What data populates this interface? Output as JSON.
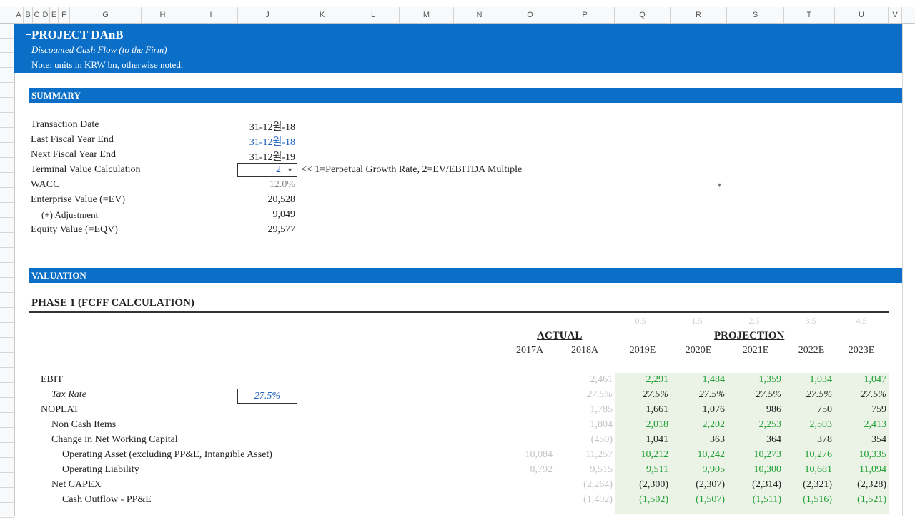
{
  "columns": [
    {
      "label": "A",
      "l": 20,
      "w": 13
    },
    {
      "label": "B",
      "l": 33,
      "w": 13
    },
    {
      "label": "C",
      "l": 46,
      "w": 12
    },
    {
      "label": "D",
      "l": 58,
      "w": 12
    },
    {
      "label": "E",
      "l": 70,
      "w": 12
    },
    {
      "label": "F",
      "l": 82,
      "w": 16
    },
    {
      "label": "G",
      "l": 98,
      "w": 100
    },
    {
      "label": "H",
      "l": 198,
      "w": 60
    },
    {
      "label": "I",
      "l": 258,
      "w": 75
    },
    {
      "label": "J",
      "l": 333,
      "w": 83
    },
    {
      "label": "K",
      "l": 416,
      "w": 70
    },
    {
      "label": "L",
      "l": 486,
      "w": 73
    },
    {
      "label": "M",
      "l": 559,
      "w": 76
    },
    {
      "label": "N",
      "l": 635,
      "w": 72
    },
    {
      "label": "O",
      "l": 707,
      "w": 70
    },
    {
      "label": "P",
      "l": 777,
      "w": 83
    },
    {
      "label": "Q",
      "l": 860,
      "w": 78
    },
    {
      "label": "R",
      "l": 938,
      "w": 79
    },
    {
      "label": "S",
      "l": 1017,
      "w": 80
    },
    {
      "label": "T",
      "l": 1097,
      "w": 71
    },
    {
      "label": "U",
      "l": 1168,
      "w": 75
    },
    {
      "label": "V",
      "l": 1243,
      "w": 19
    }
  ],
  "banner": {
    "title": "PROJECT DAnB",
    "subtitle": "Discounted Cash Flow (to the Firm)",
    "note": "Note: units in KRW bn, otherwise noted."
  },
  "summary": {
    "header": "SUMMARY",
    "items": [
      {
        "label": "Transaction Date",
        "value": "31-12월-18",
        "blue": false
      },
      {
        "label": "Last Fiscal Year End",
        "value": "31-12월-18",
        "blue": true
      },
      {
        "label": "Next Fiscal Year End",
        "value": "31-12월-19",
        "blue": false
      },
      {
        "label": "Terminal Value Calculation",
        "value": "",
        "blue": false
      },
      {
        "label": "WACC",
        "value": "12.0%",
        "blue": false
      },
      {
        "label": "Enterprise Value (=EV)",
        "value": "20,528",
        "blue": false
      },
      {
        "label": "(+) Adjustment",
        "value": "9,049",
        "blue": false
      },
      {
        "label": "Equity Value (=EQV)",
        "value": "29,577",
        "blue": false
      }
    ],
    "tv_value": "2",
    "tv_note": "<< 1=Perpetual Growth Rate, 2=EV/EBITDA Multiple"
  },
  "valuation": {
    "header": "VALUATION",
    "phase_title": "PHASE 1 (FCFF CALCULATION)",
    "actual_label": "ACTUAL",
    "projection_label": "PROJECTION",
    "years": [
      "2017A",
      "2018A",
      "2019E",
      "2020E",
      "2021E",
      "2022E",
      "2023E"
    ],
    "ticks": [
      "0.5",
      "1.5",
      "2.5",
      "3.5",
      "4.5"
    ],
    "rows": [
      {
        "label": "EBIT",
        "indent": 0,
        "italic": false,
        "a17": "",
        "a18": "2,461",
        "p": [
          "2,291",
          "1,484",
          "1,359",
          "1,034",
          "1,047"
        ],
        "pcolor": "grn"
      },
      {
        "label": "Tax Rate",
        "indent": 1,
        "italic": true,
        "a17": "",
        "a18": "27.5%",
        "p": [
          "27.5%",
          "27.5%",
          "27.5%",
          "27.5%",
          "27.5%"
        ],
        "pcolor": "blk"
      },
      {
        "label": "NOPLAT",
        "indent": 0,
        "italic": false,
        "a17": "",
        "a18": "1,785",
        "p": [
          "1,661",
          "1,076",
          "986",
          "750",
          "759"
        ],
        "pcolor": "blk"
      },
      {
        "label": "Non Cash Items",
        "indent": 1,
        "italic": false,
        "a17": "",
        "a18": "1,804",
        "p": [
          "2,018",
          "2,202",
          "2,253",
          "2,503",
          "2,413"
        ],
        "pcolor": "grn"
      },
      {
        "label": "Change in Net Working Capital",
        "indent": 1,
        "italic": false,
        "a17": "",
        "a18": "(450)",
        "p": [
          "1,041",
          "363",
          "364",
          "378",
          "354"
        ],
        "pcolor": "blk"
      },
      {
        "label": "Operating Asset (excluding PP&E, Intangible Asset)",
        "indent": 2,
        "italic": false,
        "a17": "10,084",
        "a18": "11,257",
        "p": [
          "10,212",
          "10,242",
          "10,273",
          "10,276",
          "10,335"
        ],
        "pcolor": "grn"
      },
      {
        "label": "Operating Liability",
        "indent": 2,
        "italic": false,
        "a17": "8,792",
        "a18": "9,515",
        "p": [
          "9,511",
          "9,905",
          "10,300",
          "10,681",
          "11,094"
        ],
        "pcolor": "grn"
      },
      {
        "label": "Net CAPEX",
        "indent": 1,
        "italic": false,
        "a17": "",
        "a18": "(2,264)",
        "p": [
          "(2,300)",
          "(2,307)",
          "(2,314)",
          "(2,321)",
          "(2,328)"
        ],
        "pcolor": "blk"
      },
      {
        "label": "Cash Outflow - PP&E",
        "indent": 2,
        "italic": false,
        "a17": "",
        "a18": "(1,492)",
        "p": [
          "(1,502)",
          "(1,507)",
          "(1,511)",
          "(1,516)",
          "(1,521)"
        ],
        "pcolor": "grn"
      }
    ]
  }
}
